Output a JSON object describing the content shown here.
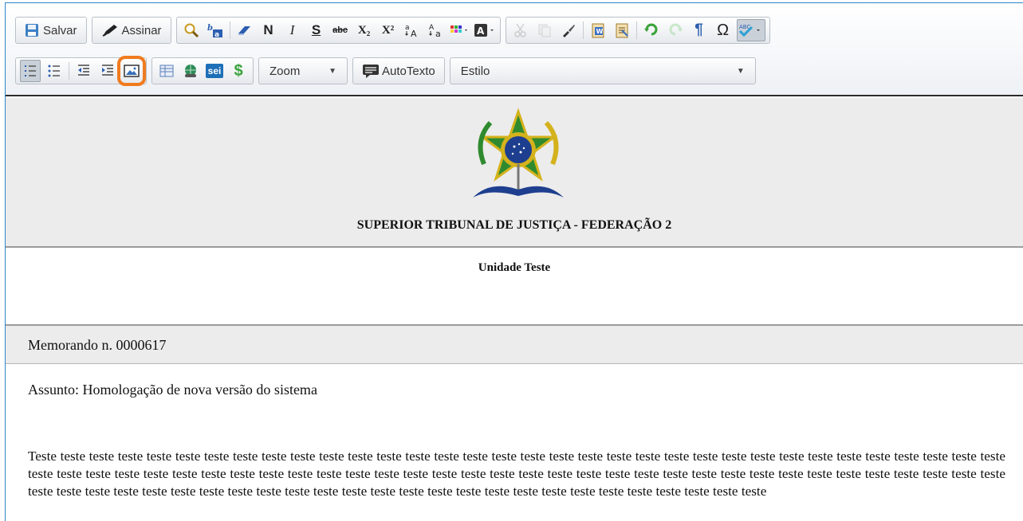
{
  "toolbar": {
    "save_label": "Salvar",
    "sign_label": "Assinar",
    "zoom_label": "Zoom",
    "autotext_label": "AutoTexto",
    "style_label": "Estilo",
    "bold_glyph": "N",
    "italic_glyph": "I",
    "underline_glyph": "S",
    "strike_glyph": "abc",
    "subscript_glyph": "X₂",
    "superscript_glyph": "X²",
    "omega_glyph": "Ω",
    "pilcrow_glyph": "¶",
    "dollar_glyph": "$",
    "sei_label": "sei",
    "highlight_color": "#f07b1f",
    "accent_color": "#2d86c6"
  },
  "document": {
    "organization": "SUPERIOR TRIBUNAL DE JUSTIÇA - FEDERAÇÃO 2",
    "unit": "Unidade Teste",
    "memo_number": "Memorando n. 0000617",
    "subject": "Assunto: Homologação de nova versão do sistema",
    "body_text": "Teste teste teste teste teste teste teste teste teste teste teste teste teste teste teste teste teste teste teste teste teste teste teste teste teste teste teste teste teste teste teste teste teste teste teste teste teste teste teste teste teste teste teste teste teste teste teste teste teste teste teste teste teste teste teste teste teste teste teste teste teste teste teste teste teste teste teste teste teste teste teste teste teste teste teste teste teste teste teste teste teste teste teste teste teste teste teste teste teste teste teste teste teste teste"
  }
}
